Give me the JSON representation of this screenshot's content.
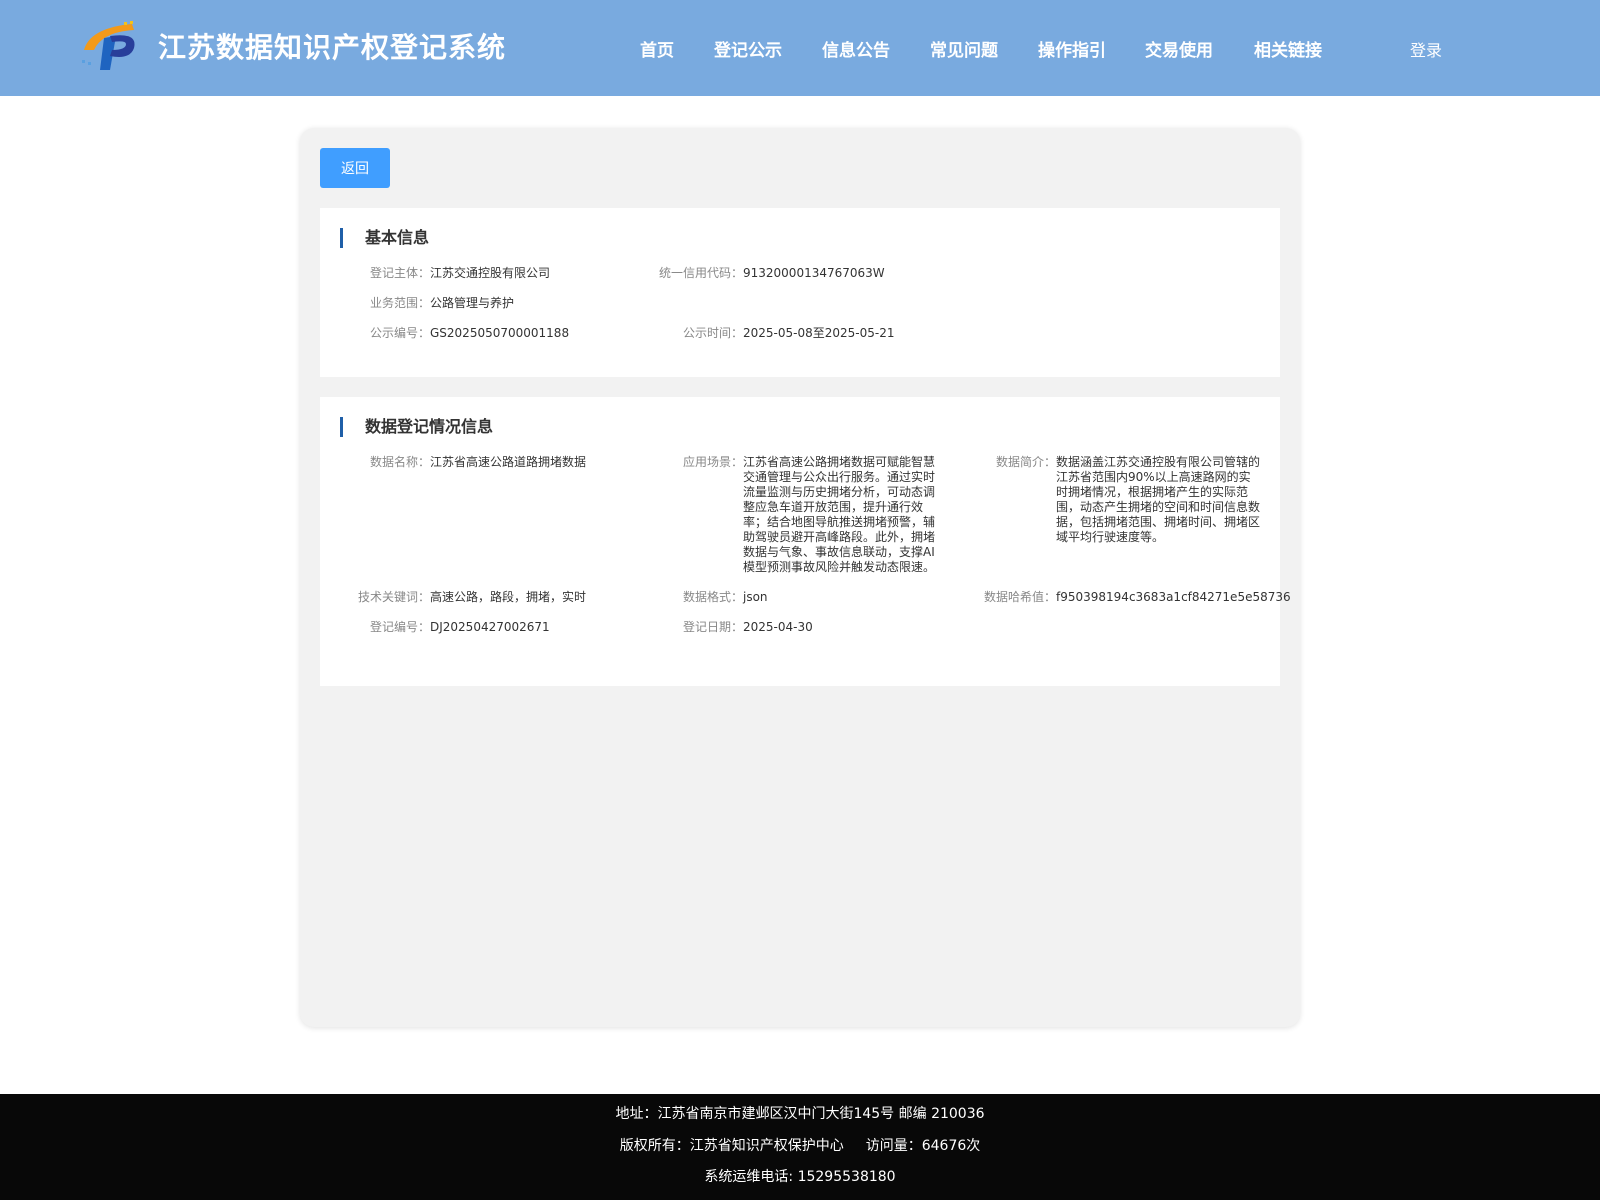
{
  "header": {
    "title": "江苏数据知识产权登记系统",
    "nav": [
      "首页",
      "登记公示",
      "信息公告",
      "常见问题",
      "操作指引",
      "交易使用",
      "相关链接"
    ],
    "login": "登录"
  },
  "back_label": "返回",
  "basic": {
    "title": "基本信息",
    "fields": [
      {
        "label": "登记主体：",
        "value": "江苏交通控股有限公司"
      },
      {
        "label": "统一信用代码：",
        "value": "91320000134767063W"
      },
      {
        "label": "业务范围：",
        "value": "公路管理与养护"
      },
      {
        "label": "公示编号：",
        "value": "GS2025050700001188"
      },
      {
        "label": "公示时间：",
        "value": "2025-05-08至2025-05-21"
      }
    ]
  },
  "data": {
    "title": "数据登记情况信息",
    "fields": [
      {
        "label": "数据名称：",
        "value": "江苏省高速公路道路拥堵数据"
      },
      {
        "label": "应用场景：",
        "value": "江苏省高速公路拥堵数据可赋能智慧交通管理与公众出行服务。通过实时流量监测与历史拥堵分析，可动态调整应急车道开放范围，提升通行效率；结合地图导航推送拥堵预警，辅助驾驶员避开高峰路段。此外，拥堵数据与气象、事故信息联动，支撑AI模型预测事故风险并触发动态限速。"
      },
      {
        "label": "数据简介：",
        "value": "数据涵盖江苏交通控股有限公司管辖的江苏省范围内90%以上高速路网的实时拥堵情况，根据拥堵产生的实际范围，动态产生拥堵的空间和时间信息数据，包括拥堵范围、拥堵时间、拥堵区域平均行驶速度等。"
      },
      {
        "label": "技术关键词：",
        "value": "高速公路，路段，拥堵，实时"
      },
      {
        "label": "数据格式：",
        "value": "json"
      },
      {
        "label": "数据哈希值：",
        "value": "f950398194c3683a1cf84271e5e58736"
      },
      {
        "label": "登记编号：",
        "value": "DJ20250427002671"
      },
      {
        "label": "登记日期：",
        "value": "2025-04-30"
      }
    ]
  },
  "footer": {
    "address": "地址：江苏省南京市建邺区汉中门大街145号 邮编 210036",
    "copyright": "版权所有：江苏省知识产权保护中心",
    "visits": "访问量：64676次",
    "phone": "系统运维电话: 15295538180"
  }
}
